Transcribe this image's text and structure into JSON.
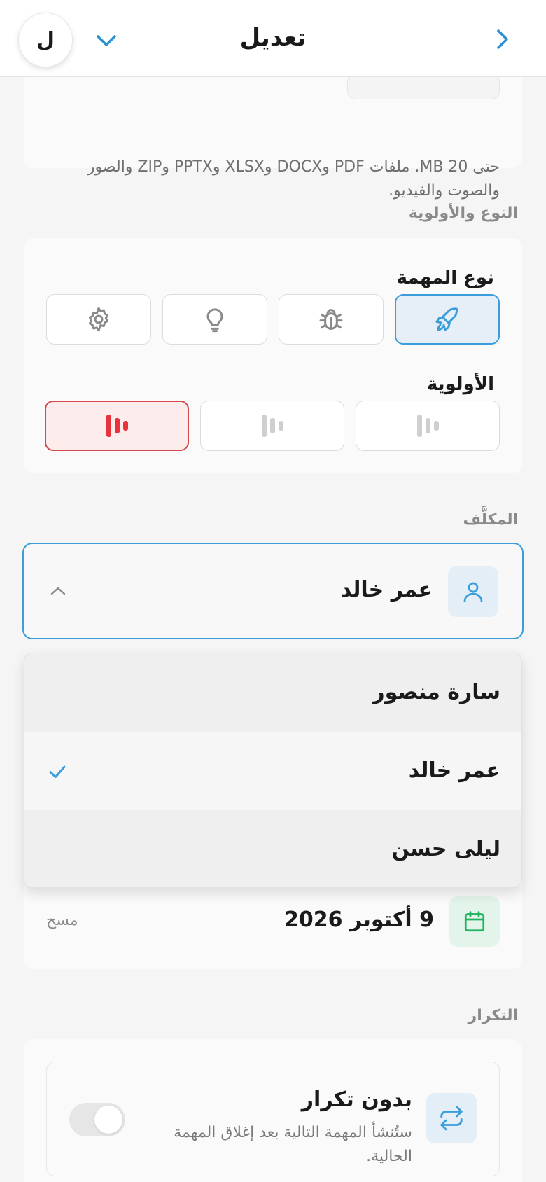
{
  "header": {
    "title": "تعديل",
    "avatar_initial": "ل"
  },
  "attachments": {
    "hint_line1": "حتى 20 MB. ملفات PDF وDOCX وXLSX وPPTX وZIP والصور",
    "hint_line2": "والصوت والفيديو."
  },
  "type_priority": {
    "section_label": "النوع والأولوية",
    "type_label": "نوع المهمة",
    "types": [
      {
        "icon": "rocket-icon",
        "selected": true
      },
      {
        "icon": "bug-icon",
        "selected": false
      },
      {
        "icon": "lightbulb-icon",
        "selected": false
      },
      {
        "icon": "gear-icon",
        "selected": false
      }
    ],
    "priority_label": "الأولوية",
    "priorities": [
      {
        "level": "low",
        "selected": false
      },
      {
        "level": "medium",
        "selected": false
      },
      {
        "level": "high",
        "selected": true
      }
    ]
  },
  "assignee": {
    "section_label": "المكلَّف",
    "selected_name": "عمر خالد",
    "options": [
      {
        "name": "سارة منصور",
        "selected": false
      },
      {
        "name": "عمر خالد",
        "selected": true
      },
      {
        "name": "ليلى حسن",
        "selected": false
      }
    ]
  },
  "due_date": {
    "value": "9 أكتوبر 2026",
    "clear_label": "مسح"
  },
  "repeat": {
    "section_label": "التكرار",
    "title": "بدون تكرار",
    "description": "ستُنشأ المهمة التالية بعد إغلاق المهمة الحالية.",
    "enabled": false
  },
  "colors": {
    "accent": "#3b9ddb",
    "priority_high": "#e8323c",
    "calendar_green": "#22b35e"
  }
}
